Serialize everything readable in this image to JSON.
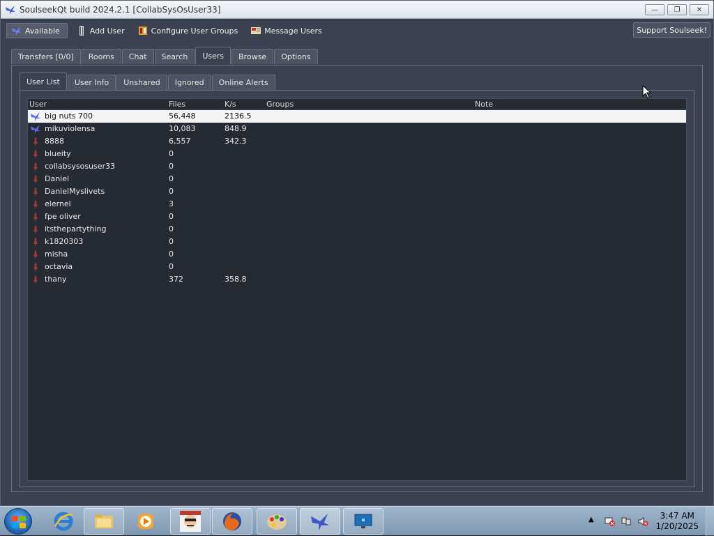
{
  "window": {
    "title": "SoulseekQt build 2024.2.1 [CollabSysOsUser33]",
    "controls": [
      "minimize",
      "restore",
      "close"
    ]
  },
  "toolbar": {
    "status_label": "Available",
    "add_user_label": "Add User",
    "configure_groups_label": "Configure User Groups",
    "message_users_label": "Message Users",
    "support_label": "Support Soulseek!"
  },
  "main_tabs": [
    {
      "label": "Transfers [0/0]"
    },
    {
      "label": "Rooms"
    },
    {
      "label": "Chat"
    },
    {
      "label": "Search"
    },
    {
      "label": "Users",
      "active": true
    },
    {
      "label": "Browse"
    },
    {
      "label": "Options"
    }
  ],
  "sub_tabs": [
    {
      "label": "User List",
      "active": true
    },
    {
      "label": "User Info"
    },
    {
      "label": "Unshared"
    },
    {
      "label": "Ignored"
    },
    {
      "label": "Online Alerts"
    }
  ],
  "list": {
    "columns": {
      "user": "User",
      "files": "Files",
      "speed": "K/s",
      "groups": "Groups",
      "note": "Note"
    },
    "rows": [
      {
        "user": "big nuts 700",
        "files": "56,448",
        "speed": "2136.5",
        "status": "online",
        "selected": true
      },
      {
        "user": "mikuviolensa",
        "files": "10,083",
        "speed": "848.9",
        "status": "online"
      },
      {
        "user": "8888",
        "files": "6,557",
        "speed": "342.3",
        "status": "offline"
      },
      {
        "user": "blueity",
        "files": "0",
        "speed": "",
        "status": "offline"
      },
      {
        "user": "collabsysosuser33",
        "files": "0",
        "speed": "",
        "status": "offline"
      },
      {
        "user": "Daniel",
        "files": "0",
        "speed": "",
        "status": "offline"
      },
      {
        "user": "DanielMyslivets",
        "files": "0",
        "speed": "",
        "status": "offline"
      },
      {
        "user": "elernel",
        "files": "3",
        "speed": "",
        "status": "offline"
      },
      {
        "user": "fpe oliver",
        "files": "0",
        "speed": "",
        "status": "offline"
      },
      {
        "user": "itsthepartything",
        "files": "0",
        "speed": "",
        "status": "offline"
      },
      {
        "user": "k1820303",
        "files": "0",
        "speed": "",
        "status": "offline"
      },
      {
        "user": "misha",
        "files": "0",
        "speed": "",
        "status": "offline"
      },
      {
        "user": "octavia",
        "files": "0",
        "speed": "",
        "status": "offline"
      },
      {
        "user": "thany",
        "files": "372",
        "speed": "358.8",
        "status": "offline"
      }
    ]
  },
  "taskbar": {
    "apps": [
      "internet-explorer-icon",
      "file-explorer-icon",
      "media-player-icon",
      "user-avatar-app-icon",
      "firefox-icon",
      "paint-icon",
      "soulseek-icon",
      "remote-desktop-icon"
    ],
    "clock_time": "3:47 AM",
    "clock_date": "1/20/2025"
  },
  "colors": {
    "window_bg": "#3b4150",
    "list_bg": "#262a33",
    "selected_row": "#f4f4f4",
    "online_bird": "#5b6fe0",
    "offline_bird": "#9a3a3a"
  }
}
